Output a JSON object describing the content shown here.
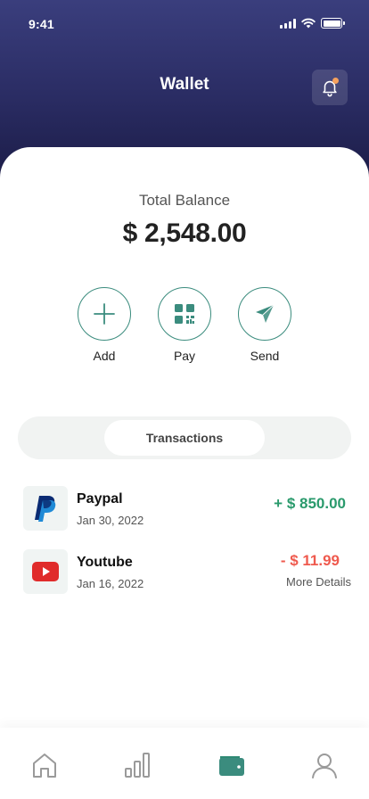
{
  "status_bar": {
    "time": "9:41"
  },
  "header": {
    "title": "Wallet",
    "bell_icon": "bell-icon",
    "notification_color": "#f5a15d"
  },
  "balance": {
    "label": "Total Balance",
    "value": "$ 2,548.00"
  },
  "actions": [
    {
      "label": "Add",
      "icon": "plus-icon"
    },
    {
      "label": "Pay",
      "icon": "qr-icon"
    },
    {
      "label": "Send",
      "icon": "send-icon"
    }
  ],
  "tabs": {
    "active": "Transactions"
  },
  "transactions": [
    {
      "name": "Paypal",
      "date": "Jan 30, 2022",
      "amount": "+ $ 850.00",
      "type": "credit",
      "icon": "paypal-icon"
    },
    {
      "name": "Youtube",
      "date": "Jan 16, 2022",
      "amount": "- $ 11.99",
      "type": "debit",
      "details": "More Details",
      "icon": "youtube-icon"
    }
  ],
  "nav": [
    {
      "icon": "home-icon",
      "active": false
    },
    {
      "icon": "stats-icon",
      "active": false
    },
    {
      "icon": "wallet-icon",
      "active": true
    },
    {
      "icon": "profile-icon",
      "active": false
    }
  ],
  "colors": {
    "accent": "#3b8c7e",
    "header_top": "#3a3e7d",
    "header_bottom": "#1c1d48",
    "credit": "#2a9a6c",
    "debit": "#ef5a4e"
  }
}
